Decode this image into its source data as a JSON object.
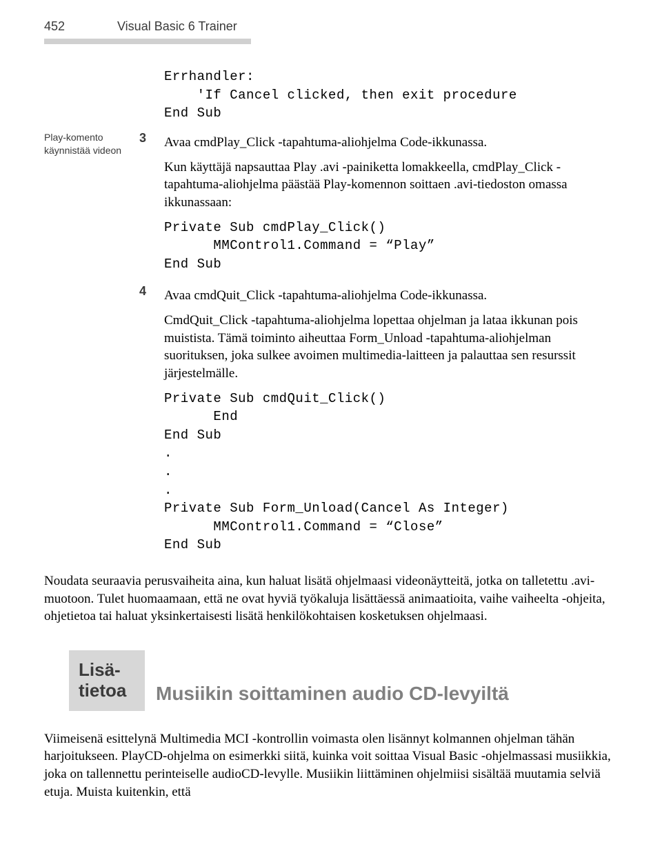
{
  "header": {
    "page_number": "452",
    "book_title": "Visual Basic 6 Trainer"
  },
  "gutter": {
    "note": "Play-komento käynnistää videon"
  },
  "code_block_0": "Errhandler:\n    'If Cancel clicked, then exit procedure\nEnd Sub",
  "step3": {
    "num": "3",
    "lead": "Avaa cmdPlay_Click -tapahtuma-aliohjelma Code-ikkunassa.",
    "para": "Kun käyttäjä napsauttaa Play .avi -painiketta lomakkeella, cmdPlay_Click -tapahtuma-aliohjelma päästää Play-komennon soittaen .avi-tiedoston omassa ikkunassaan:",
    "code": "Private Sub cmdPlay_Click()\n      MMControl1.Command = “Play”\nEnd Sub"
  },
  "step4": {
    "num": "4",
    "lead": "Avaa cmdQuit_Click -tapahtuma-aliohjelma Code-ikkunassa.",
    "para": "CmdQuit_Click -tapahtuma-aliohjelma lopettaa ohjelman ja lataa ikkunan pois muistista. Tämä toiminto aiheuttaa Form_Unload -tapahtuma-aliohjelman suorituksen, joka sulkee avoimen multimedia-laitteen ja palauttaa sen resurssit järjestelmälle.",
    "code": "Private Sub cmdQuit_Click()\n      End\nEnd Sub\n.\n.\n.\nPrivate Sub Form_Unload(Cancel As Integer)\n      MMControl1.Command = “Close”\nEnd Sub"
  },
  "closing_para": "Noudata seuraavia perusvaiheita aina, kun haluat lisätä ohjelmaasi videonäytteitä, jotka on talletettu .avi-muotoon. Tulet huomaamaan, että ne ovat hyviä työkaluja lisättäessä animaatioita, vaihe vaiheelta -ohjeita, ohjetietoa tai haluat yksinkertaisesti lisätä henkilökohtaisen kosketuksen ohjelmaasi.",
  "info": {
    "label_line1": "Lisä-",
    "label_line2": "tietoa",
    "heading": "Musiikin soittaminen audio CD-levyiltä"
  },
  "section_para": "Viimeisenä esittelynä Multimedia MCI -kontrollin voimasta olen lisännyt kolmannen ohjelman tähän harjoitukseen. PlayCD-ohjelma on esimerkki siitä, kuinka voit soittaa Visual Basic -ohjelmassasi musiikkia, joka on tallennettu perinteiselle audioCD-levylle. Musiikin liittäminen ohjelmiisi sisältää muutamia selviä etuja. Muista kuitenkin, että"
}
